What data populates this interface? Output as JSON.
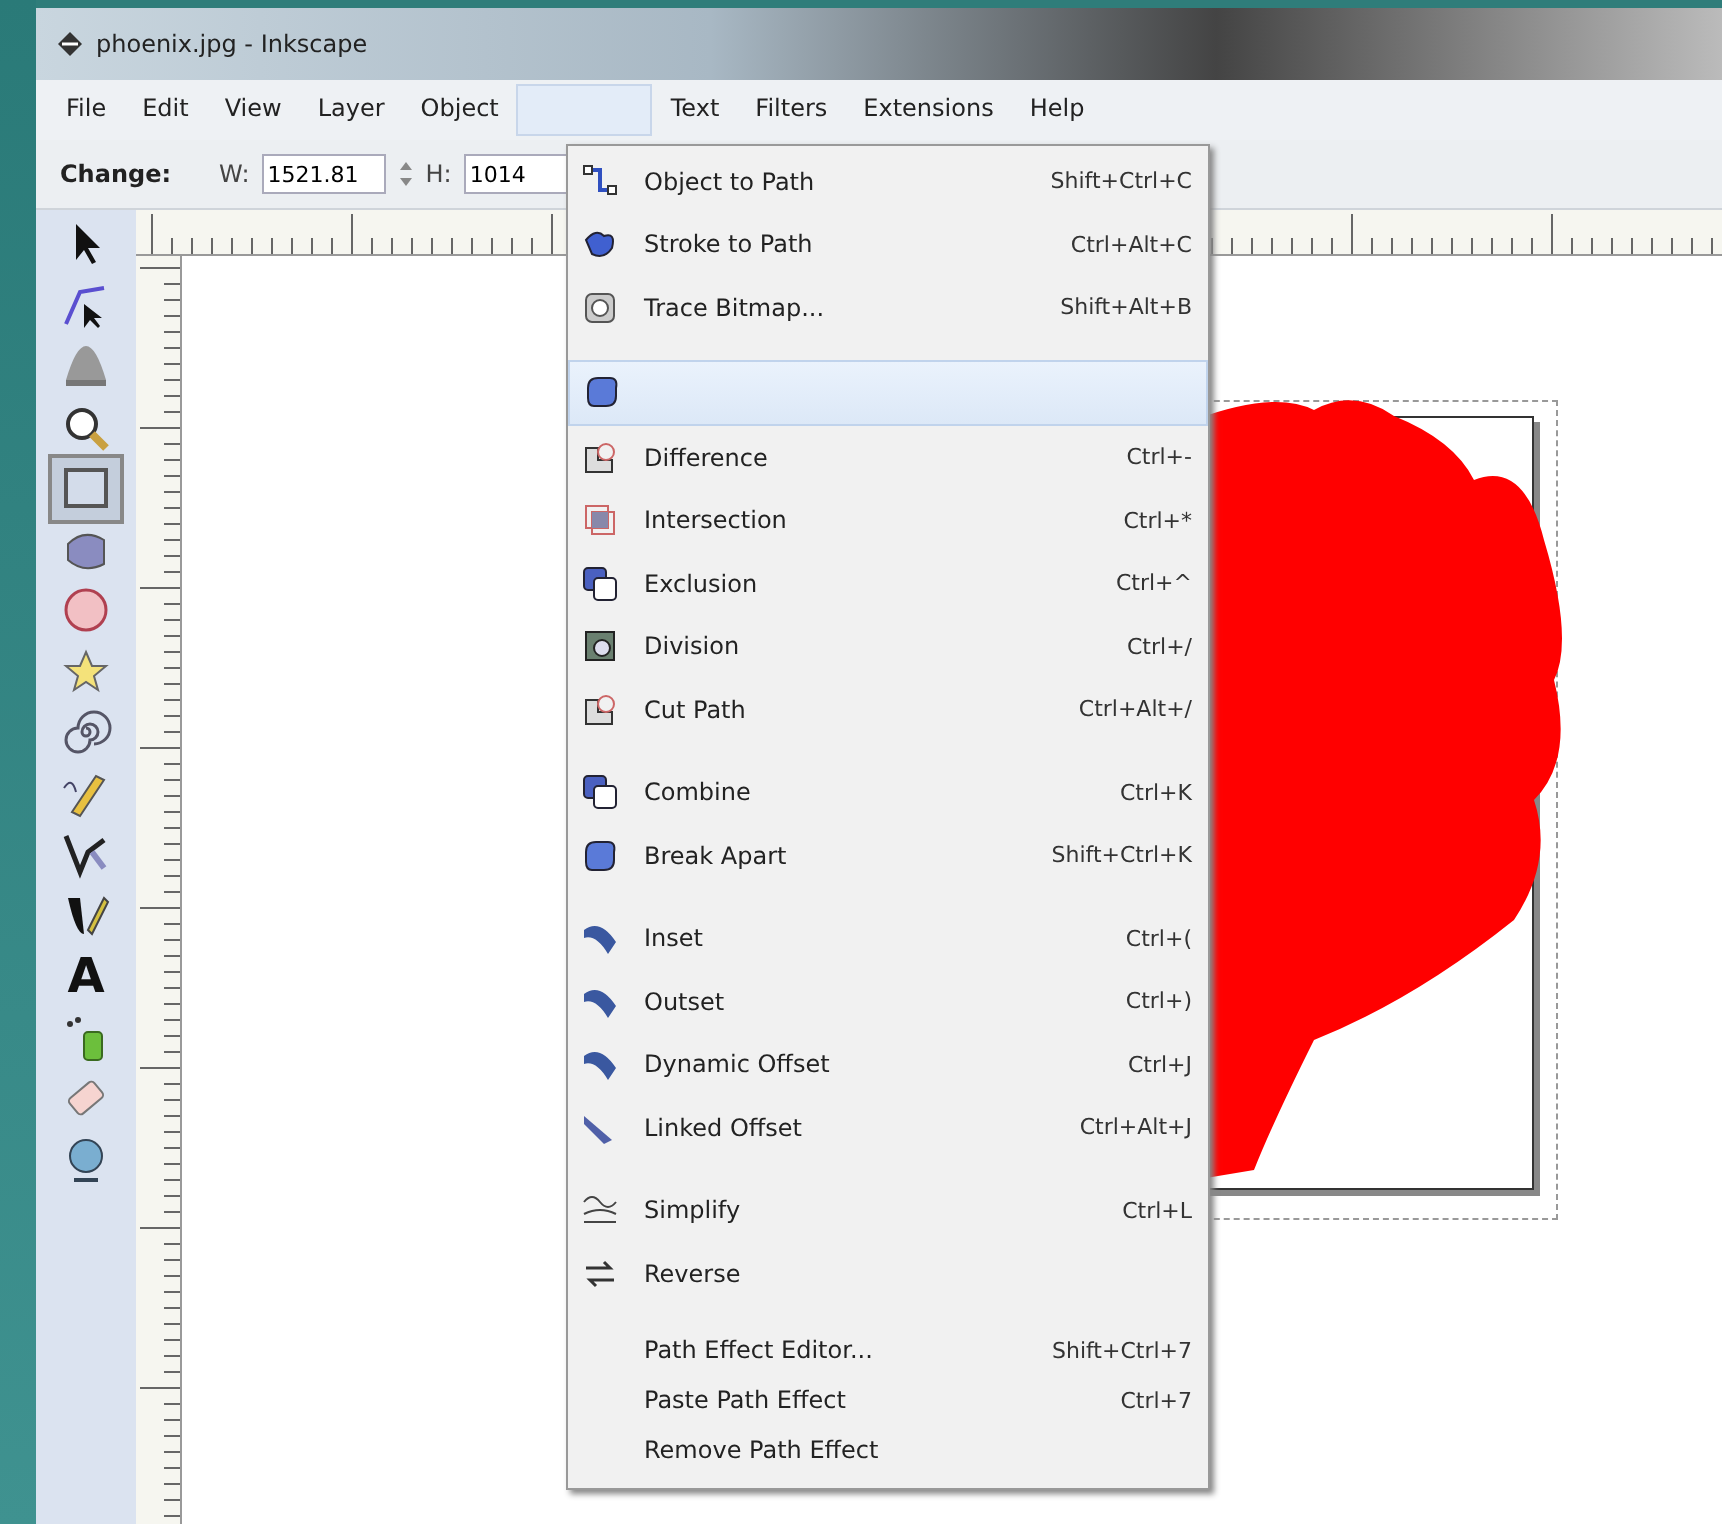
{
  "window": {
    "title": "phoenix.jpg - Inkscape"
  },
  "menubar": [
    {
      "label": "File",
      "selected": false
    },
    {
      "label": "Edit",
      "selected": false
    },
    {
      "label": "View",
      "selected": false
    },
    {
      "label": "Layer",
      "selected": false
    },
    {
      "label": "Object",
      "selected": false
    },
    {
      "selected": true
    },
    {
      "label": "Text",
      "selected": false
    },
    {
      "label": "Filters",
      "selected": false
    },
    {
      "label": "Extensions",
      "selected": false
    },
    {
      "label": "Help",
      "selected": false
    }
  ],
  "toolbar": {
    "label": "Change:",
    "w_label": "W:",
    "w_value": "1521.81",
    "h_label": "H:",
    "h_value": "1014"
  },
  "tools": [
    {
      "selected": false
    },
    {
      "selected": false
    },
    {
      "selected": false
    },
    {
      "selected": false
    },
    {
      "selected": true
    },
    {
      "selected": false
    },
    {
      "selected": false
    },
    {
      "selected": false
    },
    {
      "selected": false
    },
    {
      "selected": false
    },
    {
      "selected": false
    },
    {
      "selected": false
    },
    {
      "glyph": "A",
      "selected": false
    },
    {
      "selected": false
    },
    {
      "selected": false
    },
    {
      "selected": false
    }
  ],
  "menu": [
    {
      "kind": "nodes",
      "label": "Object to Path",
      "shortcut": "Shift+Ctrl+C",
      "selected": false
    },
    {
      "kind": "stroke",
      "label": "Stroke to Path",
      "shortcut": "Ctrl+Alt+C",
      "selected": false
    },
    {
      "kind": "trace",
      "label": "Trace Bitmap...",
      "shortcut": "Shift+Alt+B",
      "selected": false
    },
    {
      "kind": "separator"
    },
    {
      "kind": "union",
      "selected": true
    },
    {
      "kind": "difference",
      "label": "Difference",
      "shortcut": "Ctrl+-",
      "selected": false
    },
    {
      "kind": "intersection",
      "label": "Intersection",
      "shortcut": "Ctrl+*",
      "selected": false
    },
    {
      "kind": "exclusion",
      "label": "Exclusion",
      "shortcut": "Ctrl+^",
      "selected": false
    },
    {
      "kind": "division",
      "label": "Division",
      "shortcut": "Ctrl+/",
      "selected": false
    },
    {
      "kind": "difference",
      "label": "Cut Path",
      "shortcut": "Ctrl+Alt+/",
      "selected": false
    },
    {
      "kind": "separator"
    },
    {
      "kind": "exclusion",
      "label": "Combine",
      "shortcut": "Ctrl+K",
      "selected": false
    },
    {
      "kind": "union",
      "label": "Break Apart",
      "shortcut": "Shift+Ctrl+K",
      "selected": false
    },
    {
      "kind": "separator"
    },
    {
      "kind": "offset",
      "label": "Inset",
      "shortcut": "Ctrl+(",
      "selected": false
    },
    {
      "kind": "offset",
      "label": "Outset",
      "shortcut": "Ctrl+)",
      "selected": false
    },
    {
      "kind": "offset",
      "label": "Dynamic Offset",
      "shortcut": "Ctrl+J",
      "selected": false
    },
    {
      "kind": "linked",
      "label": "Linked Offset",
      "shortcut": "Ctrl+Alt+J",
      "selected": false
    },
    {
      "kind": "separator"
    },
    {
      "kind": "simplify",
      "label": "Simplify",
      "shortcut": "Ctrl+L",
      "selected": false
    },
    {
      "kind": "reverse",
      "label": "Reverse",
      "selected": false
    },
    {
      "kind": "separator"
    },
    {
      "kind": "plain",
      "label": "Path Effect Editor...",
      "shortcut": "Shift+Ctrl+7",
      "selected": false
    },
    {
      "kind": "plain",
      "label": "Paste Path Effect",
      "shortcut": "Ctrl+7",
      "selected": false
    },
    {
      "kind": "plain",
      "label": "Remove Path Effect",
      "selected": false
    }
  ]
}
